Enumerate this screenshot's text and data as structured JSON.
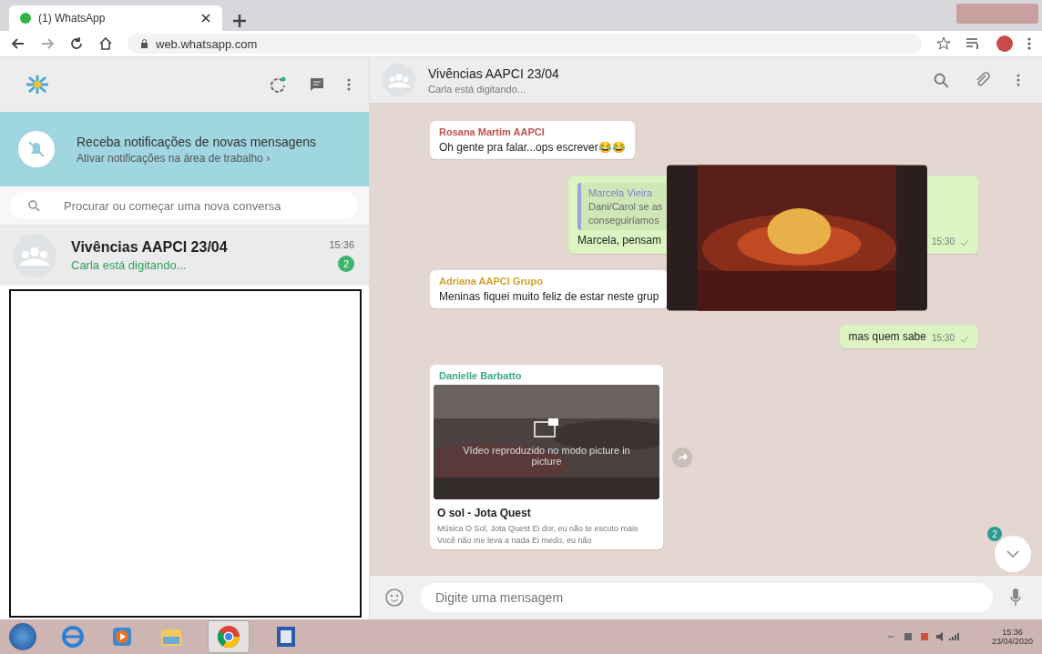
{
  "browser": {
    "tab_title": "(1) WhatsApp",
    "url": "web.whatsapp.com"
  },
  "notification": {
    "title": "Receba notificações de novas mensagens",
    "subtitle": "Ativar notificações na área de trabalho ›"
  },
  "search": {
    "placeholder": "Procurar ou começar uma nova conversa"
  },
  "chats": [
    {
      "name": "Vivências AAPCI 23/04",
      "preview": "Carla está digitando...",
      "time": "15:36",
      "unread": "2",
      "selected": true
    }
  ],
  "conversation": {
    "title": "Vivências AAPCI 23/04",
    "status": "Carla está digitando..."
  },
  "messages": [
    {
      "kind": "text",
      "outgoing": false,
      "sender": "Rosana Martim AAPCI",
      "color": "#c0504d",
      "text": "Oh gente pra falar...ops escrever😂😂"
    },
    {
      "kind": "quote",
      "outgoing": true,
      "quote_sender": "Marcela Vieira",
      "quote_lines": [
        "Dani/Carol se as",
        "conseguiríamos"
      ],
      "text": "Marcela, pensam",
      "time": "15:30"
    },
    {
      "kind": "text",
      "outgoing": false,
      "sender": "Adriana AAPCI Grupo",
      "color": "#d4a12a",
      "text": "Meninas fiquei muito feliz de estar neste grup"
    },
    {
      "kind": "text",
      "outgoing": true,
      "text": "mas quem sabe",
      "time": "15:30"
    },
    {
      "kind": "link",
      "outgoing": false,
      "sender": "Danielle Barbatto",
      "color": "#3aa88a",
      "overlay": "Vídeo reproduzido no modo picture in picture",
      "link_title": "O sol - Jota Quest",
      "link_desc": "Música O Sol, Jota Quest Ei dor, eu não te escuto mais Você não me leva a nada Ei medo, eu não"
    }
  ],
  "scroll_badge": "2",
  "composer": {
    "placeholder": "Digite uma mensagem"
  },
  "taskbar": {
    "time": "15:36",
    "date": "23/04/2020"
  }
}
